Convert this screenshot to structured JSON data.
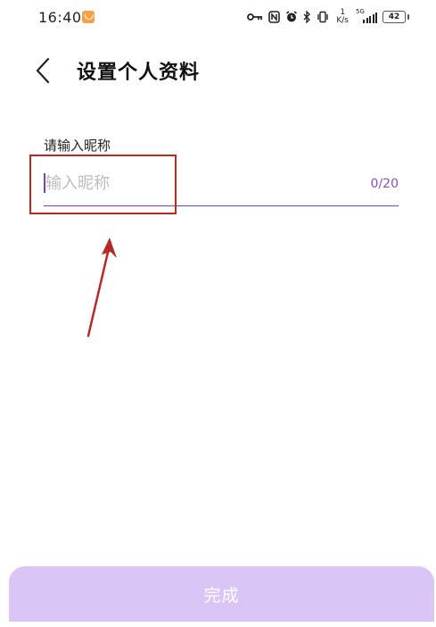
{
  "status_bar": {
    "time": "16:40",
    "net_rate_value": "1",
    "net_rate_unit": "K/s",
    "network_type": "5G",
    "battery": "42"
  },
  "header": {
    "title": "设置个人资料"
  },
  "form": {
    "label": "请输入昵称",
    "placeholder": "输入昵称",
    "value": "",
    "char_count": "0/20"
  },
  "footer": {
    "done_label": "完成"
  },
  "colors": {
    "accent": "#7f42b3",
    "button_bg": "#d9c6f7",
    "annotation": "#b52a25"
  }
}
